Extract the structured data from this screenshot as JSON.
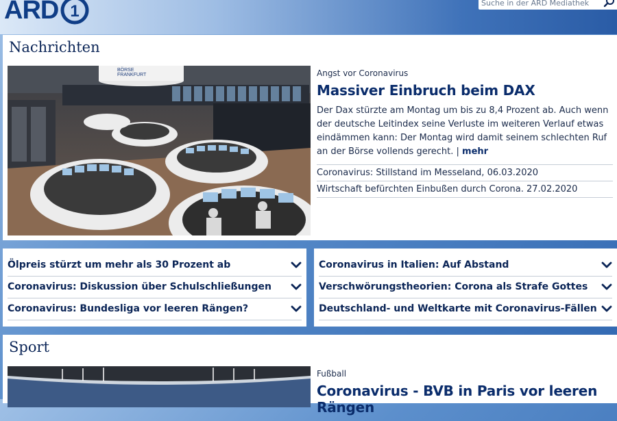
{
  "header": {
    "logo_text": "ARD",
    "logo_mark_digit": "1",
    "search_placeholder": "Suche in der ARD Mediathek"
  },
  "news": {
    "section_title": "Nachrichten",
    "kicker": "Angst vor Coronavirus",
    "headline": "Massiver Einbruch beim DAX",
    "description": "Der Dax stürzte am Montag um bis zu 8,4 Prozent ab. Auch wenn der deutsche Leitindex seine Verluste im weiteren Verlauf etwas eindämmen kann: Der Montag wird damit seinem schlechten Ruf an der Börse vollends gerecht.",
    "separator": " | ",
    "more_label": "mehr",
    "image_sign_line1": "BÖRSE",
    "image_sign_line2": "FRANKFURT",
    "related": [
      "Coronavirus: Stillstand im Messeland, 06.03.2020",
      "Wirtschaft befürchten Einbußen durch Corona. 27.02.2020"
    ]
  },
  "lists": {
    "left": [
      "Ölpreis stürzt um mehr als 30 Prozent ab",
      "Coronavirus: Diskussion über Schulschließungen",
      "Coronavirus: Bundesliga vor leeren Rängen?"
    ],
    "right": [
      "Coronavirus in Italien: Auf Abstand",
      "Verschwörungstheorien: Corona als Strafe Gottes",
      "Deutschland- und Weltkarte mit Coronavirus-Fällen"
    ]
  },
  "sport": {
    "section_title": "Sport",
    "kicker": "Fußball",
    "headline": "Coronavirus - BVB in Paris vor leeren Rängen"
  },
  "colors": {
    "brand_dark": "#0a2456",
    "accent": "#0f3d86"
  }
}
